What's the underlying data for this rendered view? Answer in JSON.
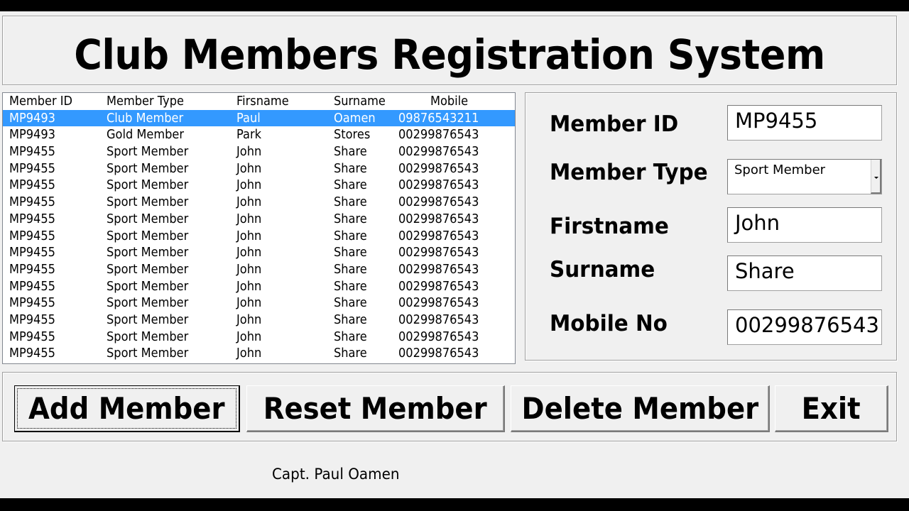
{
  "app": {
    "title": "Club Members Registration System",
    "footer_credit": "Capt. Paul Oamen",
    "colors": {
      "selection": "#3399ff",
      "window_bg": "#f0f0f0"
    }
  },
  "list": {
    "columns": [
      "Member ID",
      "Member Type",
      "Firsname",
      "Surname",
      "Mobile"
    ],
    "selected_index": 0,
    "rows": [
      [
        "MP9493",
        "Club Member",
        "Paul",
        "Oamen",
        "09876543211"
      ],
      [
        "MP9493",
        "Gold Member",
        "Park",
        "Stores",
        "00299876543"
      ],
      [
        "MP9455",
        "Sport Member",
        "John",
        "Share",
        "00299876543"
      ],
      [
        "MP9455",
        "Sport Member",
        "John",
        "Share",
        "00299876543"
      ],
      [
        "MP9455",
        "Sport Member",
        "John",
        "Share",
        "00299876543"
      ],
      [
        "MP9455",
        "Sport Member",
        "John",
        "Share",
        "00299876543"
      ],
      [
        "MP9455",
        "Sport Member",
        "John",
        "Share",
        "00299876543"
      ],
      [
        "MP9455",
        "Sport Member",
        "John",
        "Share",
        "00299876543"
      ],
      [
        "MP9455",
        "Sport Member",
        "John",
        "Share",
        "00299876543"
      ],
      [
        "MP9455",
        "Sport Member",
        "John",
        "Share",
        "00299876543"
      ],
      [
        "MP9455",
        "Sport Member",
        "John",
        "Share",
        "00299876543"
      ],
      [
        "MP9455",
        "Sport Member",
        "John",
        "Share",
        "00299876543"
      ],
      [
        "MP9455",
        "Sport Member",
        "John",
        "Share",
        "00299876543"
      ],
      [
        "MP9455",
        "Sport Member",
        "John",
        "Share",
        "00299876543"
      ],
      [
        "MP9455",
        "Sport Member",
        "John",
        "Share",
        "00299876543"
      ]
    ]
  },
  "form": {
    "member_id": {
      "label": "Member ID",
      "value": "MP9455"
    },
    "member_type": {
      "label": "Member Type",
      "value": "Sport Member"
    },
    "firstname": {
      "label": "Firstname",
      "value": "John"
    },
    "surname": {
      "label": "Surname",
      "value": "Share"
    },
    "mobile": {
      "label": "Mobile No",
      "value": "00299876543"
    }
  },
  "buttons": {
    "add": "Add Member",
    "reset": "Reset Member",
    "delete": "Delete Member",
    "exit": "Exit"
  }
}
